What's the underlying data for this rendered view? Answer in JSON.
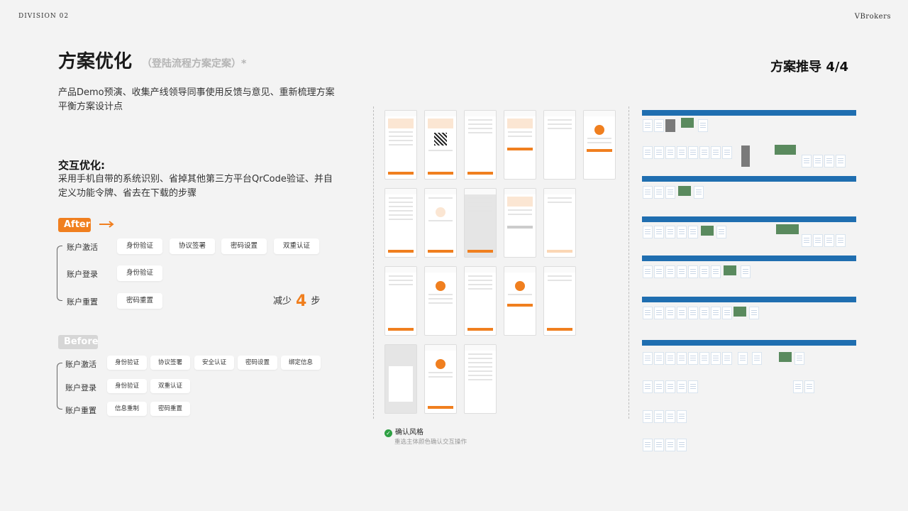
{
  "header": {
    "division": "DIVISION 02",
    "brand": "VBrokers"
  },
  "title": "方案优化",
  "subtitle": "（登陆流程方案定案）*",
  "page_indicator": "方案推导  4/4",
  "description": "产品Demo预演、收集产线领导同事使用反馈与意见、重新梳理方案平衡方案设计点",
  "interaction": {
    "title": "交互优化:",
    "text": "采用手机自带的系统识别、省掉其他第三方平台QrCode验证、并自定义功能令牌、省去在下载的步骤"
  },
  "after": {
    "badge": "After",
    "rows": [
      {
        "label": "账户激活",
        "steps": [
          "身份验证",
          "协议签署",
          "密码设置",
          "双重认证"
        ]
      },
      {
        "label": "账户登录",
        "steps": [
          "身份验证"
        ]
      },
      {
        "label": "账户重置",
        "steps": [
          "密码重置"
        ]
      }
    ],
    "reduce_prefix": "减少",
    "reduce_num": "4",
    "reduce_suffix": "步"
  },
  "before": {
    "badge": "Before",
    "rows": [
      {
        "label": "账户激活",
        "steps": [
          "身份验证",
          "协议签署",
          "安全认证",
          "密码设置",
          "绑定信息"
        ]
      },
      {
        "label": "账户登录",
        "steps": [
          "身份验证",
          "双重认证"
        ]
      },
      {
        "label": "账户重置",
        "steps": [
          "信息重制",
          "密码重置"
        ]
      }
    ]
  },
  "confirm": {
    "title": "确认风格",
    "subtitle": "重选主体颜色确认交互操作"
  },
  "colors": {
    "accent": "#f07f1f",
    "flow_blue": "#1f6eb0",
    "flow_green": "#5a8a5e"
  }
}
